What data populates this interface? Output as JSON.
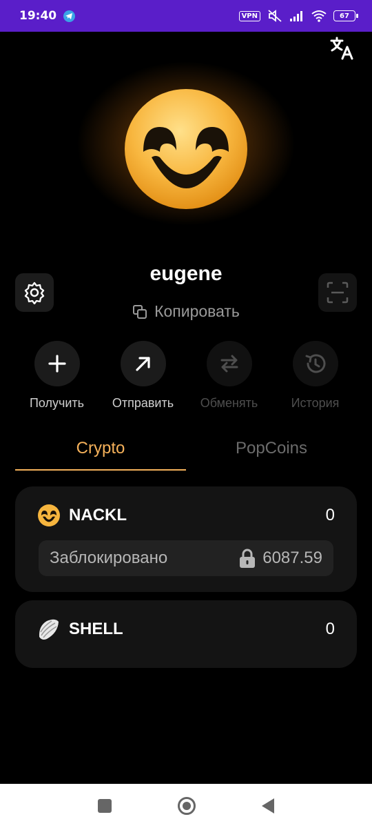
{
  "status_bar": {
    "time": "19:40",
    "vpn_label": "VPN",
    "battery": "67",
    "icons": [
      "telegram-icon",
      "vpn-icon",
      "muted-icon",
      "signal-icon",
      "wifi-icon",
      "battery-icon"
    ]
  },
  "header": {
    "translate_icon": "translate-icon"
  },
  "profile": {
    "username": "eugene",
    "copy_label": "Копировать",
    "avatar_icon": "smiley-avatar",
    "settings_icon": "gear-icon",
    "scan_icon": "scan-icon"
  },
  "actions": [
    {
      "label": "Получить",
      "icon": "plus-icon",
      "enabled": true
    },
    {
      "label": "Отправить",
      "icon": "arrow-up-right-icon",
      "enabled": true
    },
    {
      "label": "Обменять",
      "icon": "swap-icon",
      "enabled": false
    },
    {
      "label": "История",
      "icon": "history-icon",
      "enabled": false
    }
  ],
  "tabs": [
    {
      "label": "Crypto",
      "active": true
    },
    {
      "label": "PopCoins",
      "active": false
    }
  ],
  "tokens": [
    {
      "name": "NACKL",
      "amount": "0",
      "icon": "smiley-icon",
      "locked_label": "Заблокировано",
      "locked_amount": "6087.59"
    },
    {
      "name": "SHELL",
      "amount": "0",
      "icon": "shell-icon"
    }
  ],
  "colors": {
    "status_bar": "#5a1ec9",
    "accent": "#f5b15a",
    "card": "#141414",
    "background": "#000000"
  }
}
